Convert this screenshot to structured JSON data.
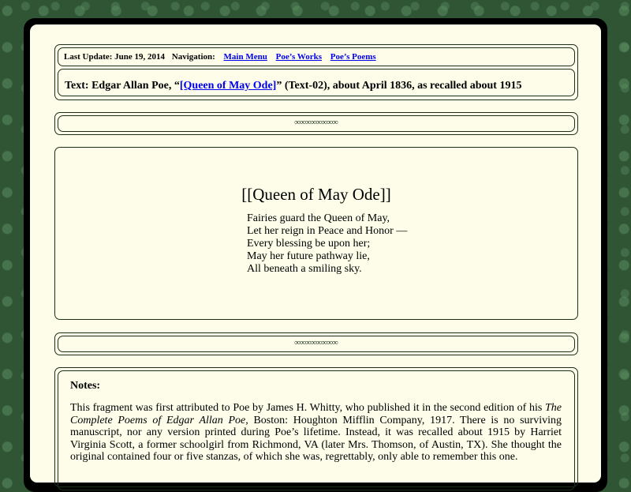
{
  "header": {
    "last_update_label": "Last Update: June 19, 2014",
    "navigation_label": "Navigation:",
    "links": [
      "Main Menu",
      "Poe’s Works",
      "Poe’s Poems"
    ]
  },
  "text_line": {
    "prefix": "Text: Edgar Allan Poe, “",
    "link": "[Queen of May Ode]",
    "suffix": "” (Text-02), about April 1836, as recalled about 1915"
  },
  "ornament": "∞∞∞∞∞∞∞∞",
  "poem": {
    "title": "[[Queen of May Ode]]",
    "lines": [
      "Fairies guard the Queen of May,",
      "Let her reign in Peace and Honor —",
      "Every blessing be upon her;",
      "May her future pathway lie,",
      "All beneath a smiling sky."
    ]
  },
  "notes": {
    "heading": "Notes:",
    "p1_a": "This fragment was first attributed to Poe by James H. Whitty, who published it in the second edition of his ",
    "p1_book": "The Complete Poems of Edgar Allan Poe",
    "p1_b": ", Boston: Houghton Mifflin Company, 1917. There is no surviving manuscript, nor any version printed during Poe’s lifetime. Instead, it was recalled about 1915 by Harriet Virginia Scott, a former schoolgirl from Richmond, VA (later Mrs. Thomson, of Austin, TX). She thought the original contained four or five stanzas, of which she was, regrettably, only able to remember this one."
  }
}
